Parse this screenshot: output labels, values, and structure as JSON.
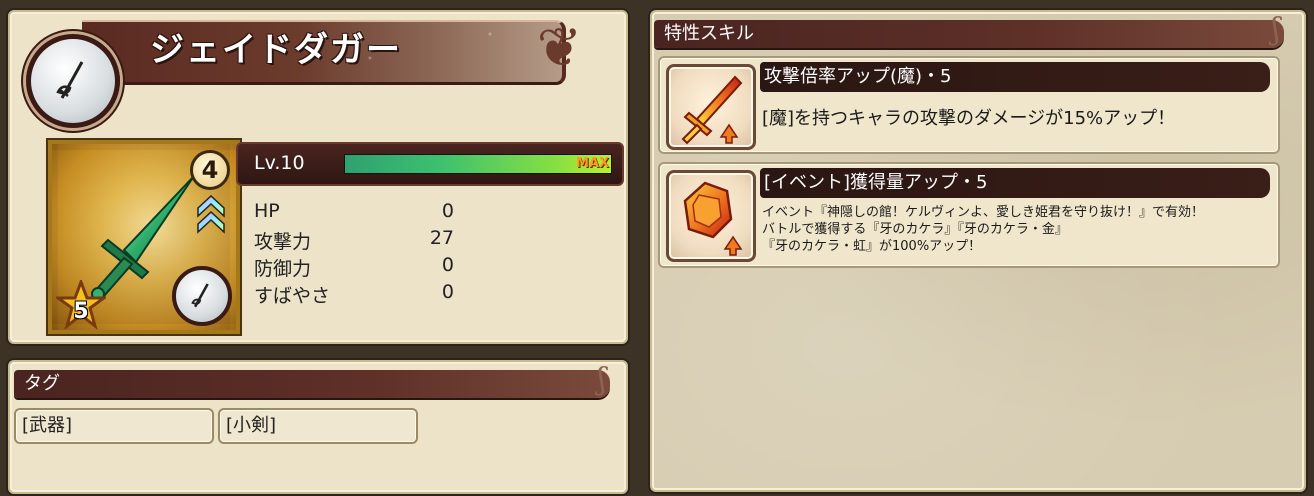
{
  "item": {
    "name": "ジェイドダガー",
    "rarity": "4",
    "stars": "5",
    "level": "Lv.10",
    "level_max_label": "MAX",
    "level_progress": 1.0,
    "stats": [
      {
        "label": "HP",
        "value": "0"
      },
      {
        "label": "攻撃力",
        "value": "27"
      },
      {
        "label": "防御力",
        "value": "0"
      },
      {
        "label": "すばやさ",
        "value": "0"
      }
    ]
  },
  "tags": {
    "header": "タグ",
    "items": [
      "[武器]",
      "[小剣]"
    ]
  },
  "skills": {
    "header": "特性スキル",
    "items": [
      {
        "title": "攻撃倍率アップ(魔)・5",
        "desc": [
          "[魔]を持つキャラの攻撃のダメージが15%アップ！"
        ],
        "icon": "sword-up-icon"
      },
      {
        "title": "[イベント]獲得量アップ・5",
        "desc": [
          "イベント『神隠しの館！ケルヴィンよ、愛しき姫君を守り抜け！』で有効！",
          "バトルで獲得する『牙のカケラ』『牙のカケラ・金』",
          "『牙のカケラ・虹』が100%アップ！"
        ],
        "icon": "gem-up-icon"
      }
    ]
  },
  "colors": {
    "header_bg": "#4a2420",
    "panel_bg": "#ece3c9",
    "bar_fill": "#3cc070",
    "max_label": "#ff9a1e"
  }
}
